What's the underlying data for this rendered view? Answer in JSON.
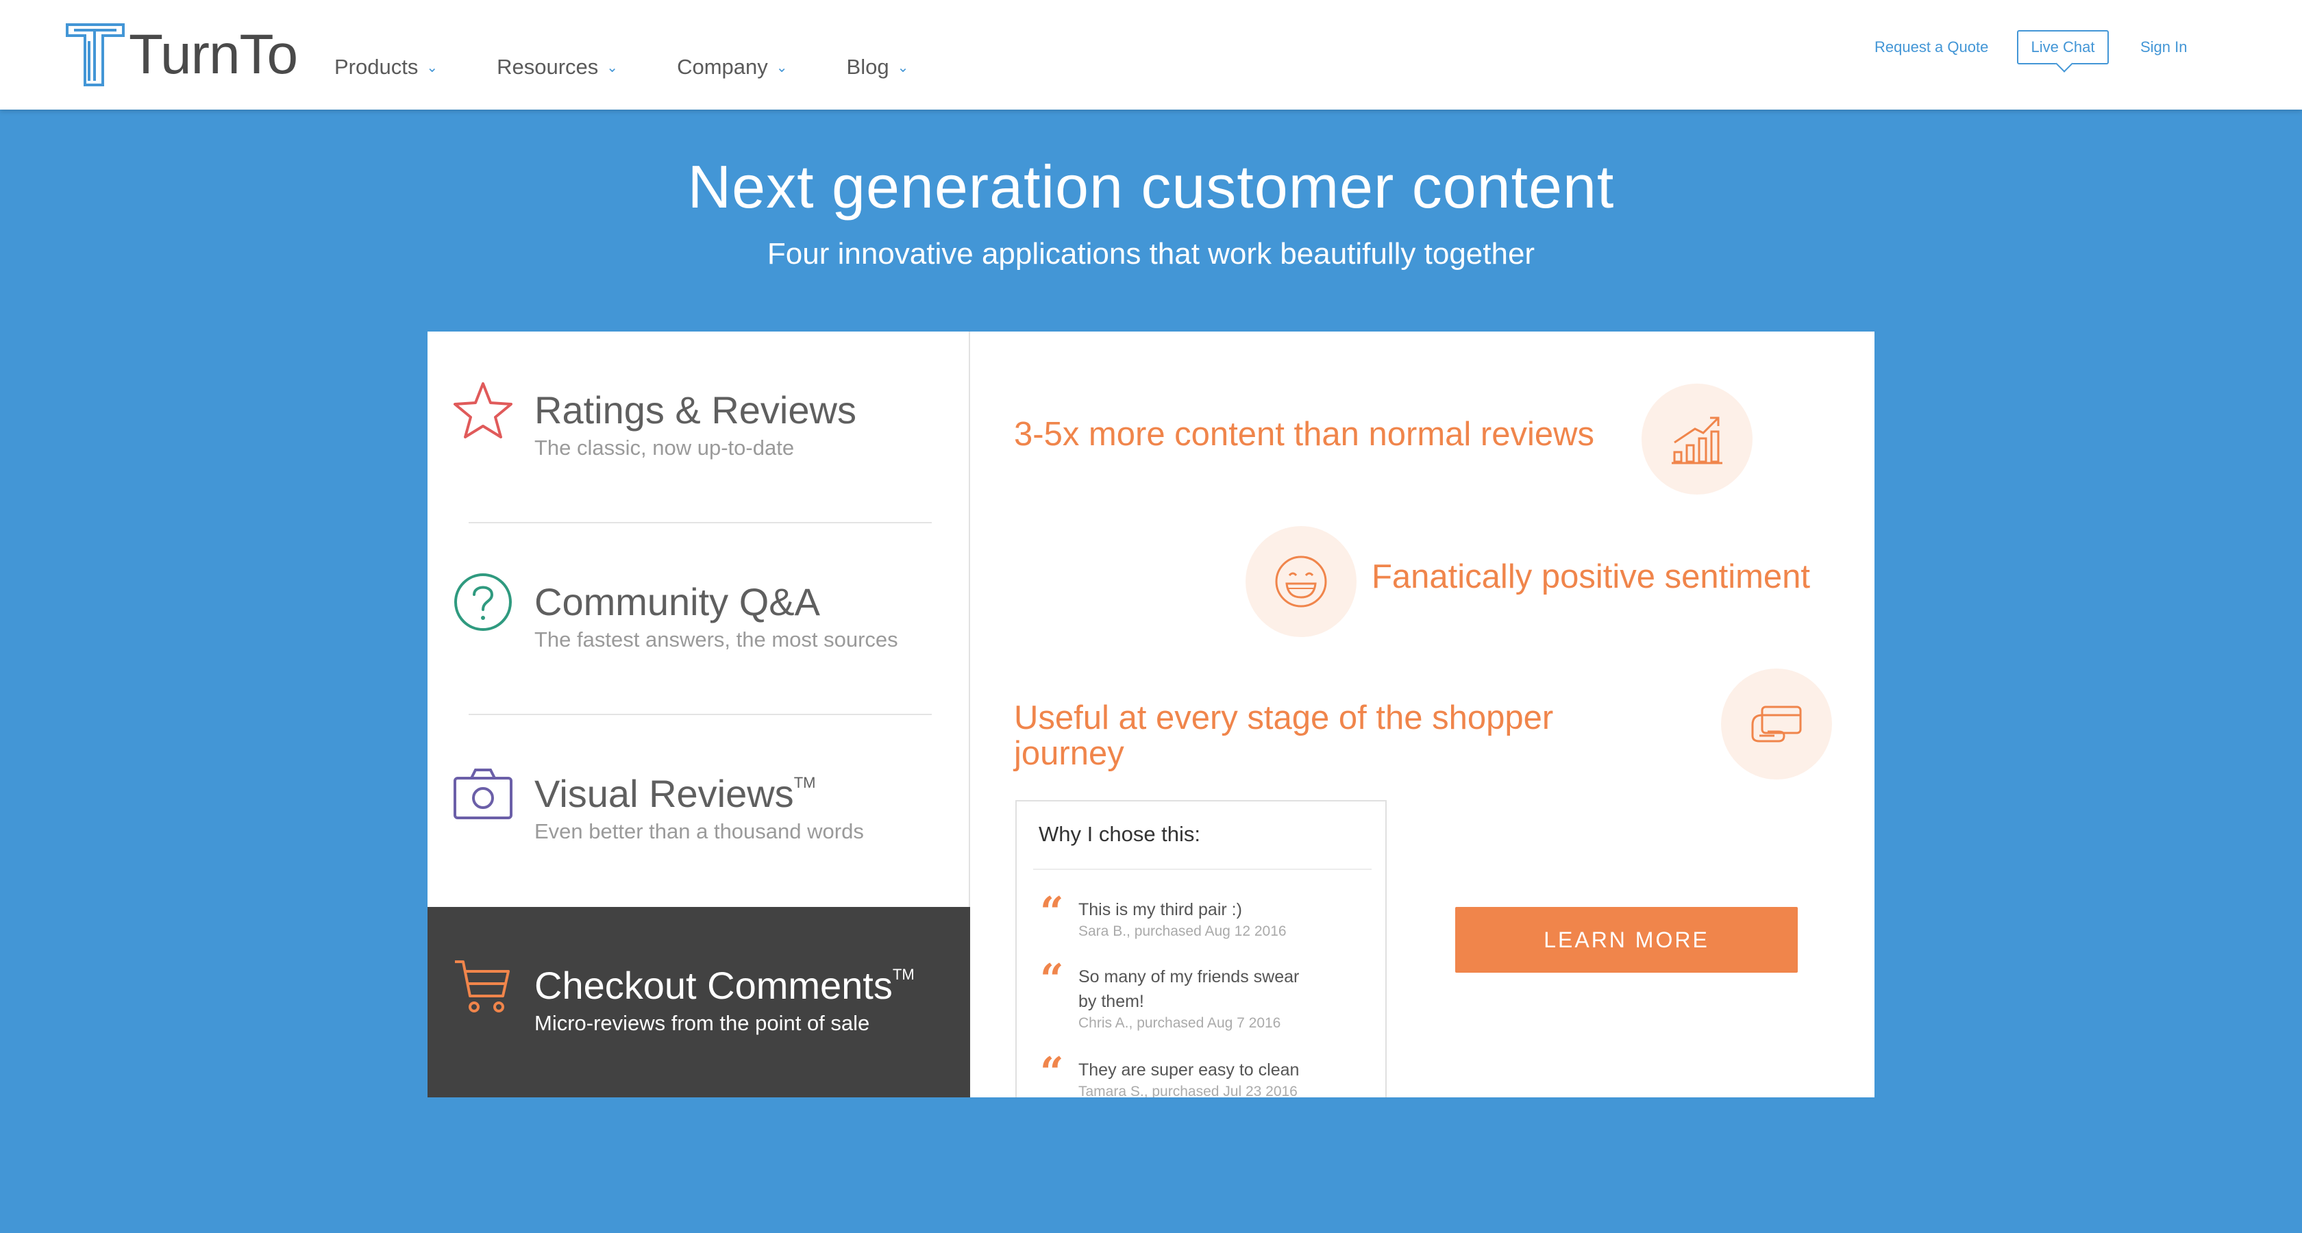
{
  "header": {
    "logo_text": "TurnTo",
    "nav": [
      {
        "label": "Products"
      },
      {
        "label": "Resources"
      },
      {
        "label": "Company"
      },
      {
        "label": "Blog"
      }
    ],
    "request_quote": "Request a Quote",
    "live_chat": "Live Chat",
    "sign_in": "Sign In"
  },
  "hero": {
    "title": "Next generation customer content",
    "subtitle": "Four innovative applications that work beautifully together"
  },
  "products": [
    {
      "title": "Ratings & Reviews",
      "tm": "",
      "subtitle": "The classic, now up-to-date",
      "icon": "star-icon"
    },
    {
      "title": "Community Q&A",
      "tm": "",
      "subtitle": "The fastest answers, the most sources",
      "icon": "question-circle-icon"
    },
    {
      "title": "Visual Reviews",
      "tm": "TM",
      "subtitle": "Even better than a thousand words",
      "icon": "camera-icon"
    },
    {
      "title": "Checkout Comments",
      "tm": "TM",
      "subtitle": "Micro-reviews from the point of sale",
      "icon": "shopping-cart-icon"
    }
  ],
  "benefits": [
    {
      "text": "3-5x more content than normal reviews",
      "icon": "growth-chart-icon"
    },
    {
      "text": "Fanatically positive sentiment",
      "icon": "smiley-face-icon"
    },
    {
      "text_line1": "Useful at every stage of the shopper",
      "text_line2": "journey",
      "icon": "hand-card-icon"
    }
  ],
  "review_card": {
    "title": "Why I chose this:",
    "reviews": [
      {
        "line1": "This is my third pair :)",
        "line2": "",
        "meta": "Sara B., purchased Aug 12 2016"
      },
      {
        "line1": "So many of my friends swear",
        "line2": "by them!",
        "meta": "Chris A., purchased Aug 7 2016"
      },
      {
        "line1": "They are super easy to clean",
        "line2": "",
        "meta": "Tamara S., purchased Jul 23 2016"
      }
    ]
  },
  "cta": {
    "learn_more": "LEARN MORE"
  },
  "colors": {
    "brand_blue": "#4396d6",
    "accent_orange": "#f0854b",
    "dark_panel": "#424242"
  }
}
